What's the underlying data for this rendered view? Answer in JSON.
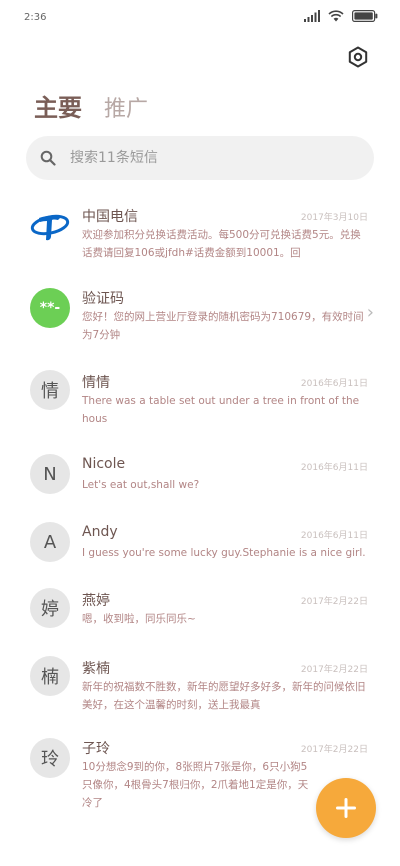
{
  "status_bar": {
    "time": "2:36"
  },
  "tabs": {
    "main": "主要",
    "promo": "推广"
  },
  "search": {
    "placeholder": "搜索11条短信"
  },
  "messages": [
    {
      "sender": "中国电信",
      "date": "2017年3月10日",
      "snippet": "欢迎参加积分兑换话费活动。每500分可兑换话费5元。兑换话费请回复106或jfdh#话费金额到10001。回"
    },
    {
      "sender": "验证码",
      "avatar_text": "**-",
      "snippet": "您好！您的网上营业厅登录的随机密码为710679，有效时间为7分钟"
    },
    {
      "sender": "情情",
      "avatar_text": "情",
      "date": "2016年6月11日",
      "snippet": "There was a table set out under a tree in front of the hous"
    },
    {
      "sender": "Nicole",
      "avatar_text": "N",
      "date": "2016年6月11日",
      "snippet": "Let's eat out,shall we?"
    },
    {
      "sender": "Andy",
      "avatar_text": "A",
      "date": "2016年6月11日",
      "snippet": "I guess you're some lucky guy.Stephanie is a nice girl."
    },
    {
      "sender": "燕婷",
      "avatar_text": "婷",
      "date": "2017年2月22日",
      "snippet": "嗯，收到啦，同乐同乐~"
    },
    {
      "sender": "紫楠",
      "avatar_text": "楠",
      "date": "2017年2月22日",
      "snippet": "新年的祝福数不胜数，新年的愿望好多好多，新年的问候依旧美好，在这个温馨的时刻，送上我最真"
    },
    {
      "sender": "子玲",
      "avatar_text": "玲",
      "date": "2017年2月22日",
      "snippet": "10分想念9到的你，8张照片7张是你，6只小狗5只像你，4根骨头7根归你，2爪着地1定是你，天冷了"
    }
  ],
  "colors": {
    "accent": "#f6a93b",
    "sender": "#6e5651",
    "snippet": "#b28585",
    "avatar_bg": "#e6e6e6",
    "verify_avatar": "#6ccf55",
    "telecom_blue": "#0a67c7"
  },
  "icons": {
    "settings": "gear-icon",
    "search": "search-icon",
    "fab": "plus-icon",
    "chevron": "chevron-right-icon",
    "telecom": "china-telecom-logo"
  }
}
